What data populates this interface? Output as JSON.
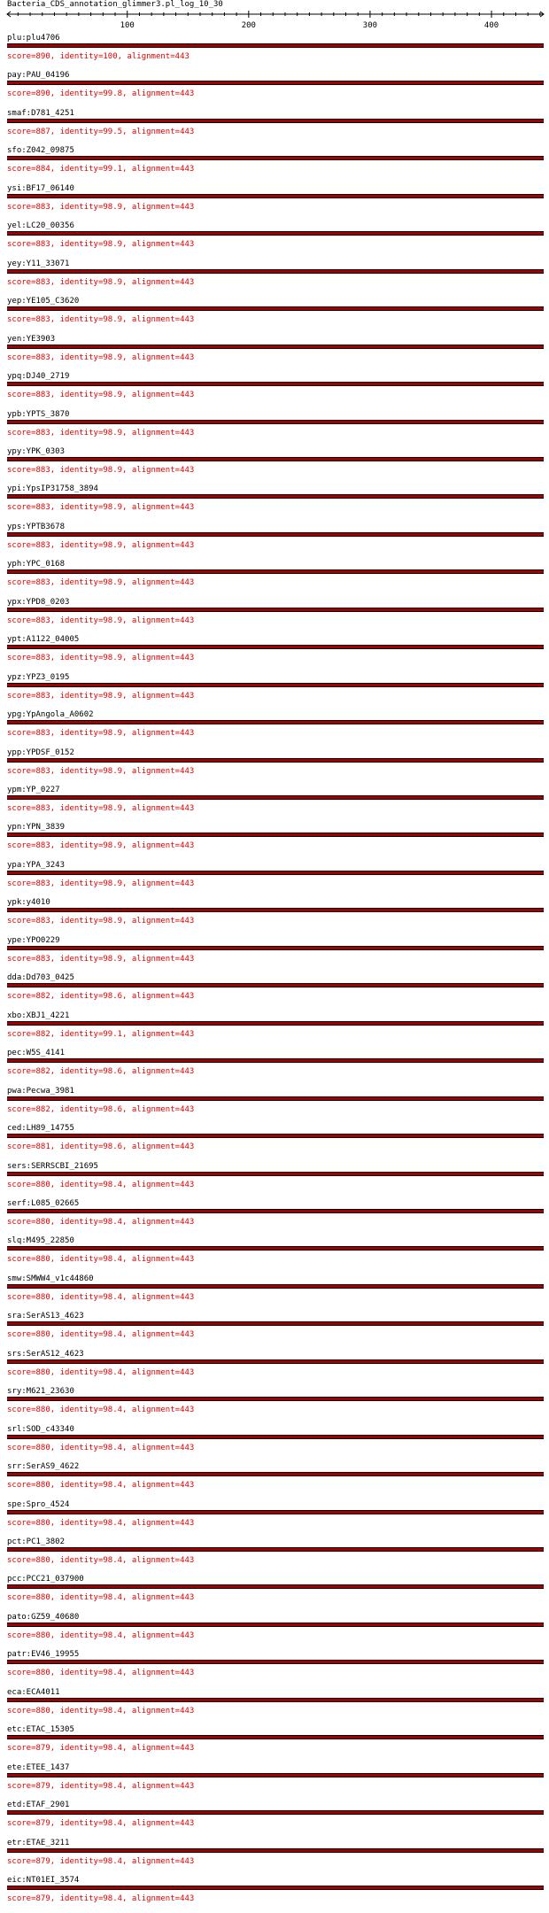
{
  "title": "Bacteria_CDS_annotation_glimmer3.pl_log_10_30",
  "ruler": {
    "min": 1,
    "max": 443,
    "labels": [
      "100",
      "200",
      "300",
      "400"
    ],
    "label_values": [
      100,
      200,
      300,
      400
    ]
  },
  "colors": {
    "bar": "#a00000",
    "bar_border": "#000000",
    "score_text": "#e00000"
  },
  "hits": [
    {
      "name": "plu:plu4706",
      "score": "score=890, identity=100, alignment=443"
    },
    {
      "name": "pay:PAU_04196",
      "score": "score=890, identity=99.8, alignment=443"
    },
    {
      "name": "smaf:D781_4251",
      "score": "score=887, identity=99.5, alignment=443"
    },
    {
      "name": "sfo:Z042_09875",
      "score": "score=884, identity=99.1, alignment=443"
    },
    {
      "name": "ysi:BF17_06140",
      "score": "score=883, identity=98.9, alignment=443"
    },
    {
      "name": "yel:LC20_00356",
      "score": "score=883, identity=98.9, alignment=443"
    },
    {
      "name": "yey:Y11_33071",
      "score": "score=883, identity=98.9, alignment=443"
    },
    {
      "name": "yep:YE105_C3620",
      "score": "score=883, identity=98.9, alignment=443"
    },
    {
      "name": "yen:YE3903",
      "score": "score=883, identity=98.9, alignment=443"
    },
    {
      "name": "ypq:DJ40_2719",
      "score": "score=883, identity=98.9, alignment=443"
    },
    {
      "name": "ypb:YPTS_3870",
      "score": "score=883, identity=98.9, alignment=443"
    },
    {
      "name": "ypy:YPK_0303",
      "score": "score=883, identity=98.9, alignment=443"
    },
    {
      "name": "ypi:YpsIP31758_3894",
      "score": "score=883, identity=98.9, alignment=443"
    },
    {
      "name": "yps:YPTB3678",
      "score": "score=883, identity=98.9, alignment=443"
    },
    {
      "name": "yph:YPC_0168",
      "score": "score=883, identity=98.9, alignment=443"
    },
    {
      "name": "ypx:YPD8_0203",
      "score": "score=883, identity=98.9, alignment=443"
    },
    {
      "name": "ypt:A1122_04005",
      "score": "score=883, identity=98.9, alignment=443"
    },
    {
      "name": "ypz:YPZ3_0195",
      "score": "score=883, identity=98.9, alignment=443"
    },
    {
      "name": "ypg:YpAngola_A0602",
      "score": "score=883, identity=98.9, alignment=443"
    },
    {
      "name": "ypp:YPDSF_0152",
      "score": "score=883, identity=98.9, alignment=443"
    },
    {
      "name": "ypm:YP_0227",
      "score": "score=883, identity=98.9, alignment=443"
    },
    {
      "name": "ypn:YPN_3839",
      "score": "score=883, identity=98.9, alignment=443"
    },
    {
      "name": "ypa:YPA_3243",
      "score": "score=883, identity=98.9, alignment=443"
    },
    {
      "name": "ypk:y4010",
      "score": "score=883, identity=98.9, alignment=443"
    },
    {
      "name": "ype:YPO0229",
      "score": "score=883, identity=98.9, alignment=443"
    },
    {
      "name": "dda:Dd703_0425",
      "score": "score=882, identity=98.6, alignment=443"
    },
    {
      "name": "xbo:XBJ1_4221",
      "score": "score=882, identity=99.1, alignment=443"
    },
    {
      "name": "pec:W5S_4141",
      "score": "score=882, identity=98.6, alignment=443"
    },
    {
      "name": "pwa:Pecwa_3981",
      "score": "score=882, identity=98.6, alignment=443"
    },
    {
      "name": "ced:LH89_14755",
      "score": "score=881, identity=98.6, alignment=443"
    },
    {
      "name": "sers:SERRSCBI_21695",
      "score": "score=880, identity=98.4, alignment=443"
    },
    {
      "name": "serf:L085_02665",
      "score": "score=880, identity=98.4, alignment=443"
    },
    {
      "name": "slq:M495_22850",
      "score": "score=880, identity=98.4, alignment=443"
    },
    {
      "name": "smw:SMWW4_v1c44860",
      "score": "score=880, identity=98.4, alignment=443"
    },
    {
      "name": "sra:SerAS13_4623",
      "score": "score=880, identity=98.4, alignment=443"
    },
    {
      "name": "srs:SerAS12_4623",
      "score": "score=880, identity=98.4, alignment=443"
    },
    {
      "name": "sry:M621_23630",
      "score": "score=880, identity=98.4, alignment=443"
    },
    {
      "name": "srl:SOD_c43340",
      "score": "score=880, identity=98.4, alignment=443"
    },
    {
      "name": "srr:SerAS9_4622",
      "score": "score=880, identity=98.4, alignment=443"
    },
    {
      "name": "spe:Spro_4524",
      "score": "score=880, identity=98.4, alignment=443"
    },
    {
      "name": "pct:PC1_3802",
      "score": "score=880, identity=98.4, alignment=443"
    },
    {
      "name": "pcc:PCC21_037900",
      "score": "score=880, identity=98.4, alignment=443"
    },
    {
      "name": "pato:GZ59_40680",
      "score": "score=880, identity=98.4, alignment=443"
    },
    {
      "name": "patr:EV46_19955",
      "score": "score=880, identity=98.4, alignment=443"
    },
    {
      "name": "eca:ECA4011",
      "score": "score=880, identity=98.4, alignment=443"
    },
    {
      "name": "etc:ETAC_15305",
      "score": "score=879, identity=98.4, alignment=443"
    },
    {
      "name": "ete:ETEE_1437",
      "score": "score=879, identity=98.4, alignment=443"
    },
    {
      "name": "etd:ETAF_2901",
      "score": "score=879, identity=98.4, alignment=443"
    },
    {
      "name": "etr:ETAE_3211",
      "score": "score=879, identity=98.4, alignment=443"
    },
    {
      "name": "eic:NT01EI_3574",
      "score": "score=879, identity=98.4, alignment=443"
    }
  ]
}
